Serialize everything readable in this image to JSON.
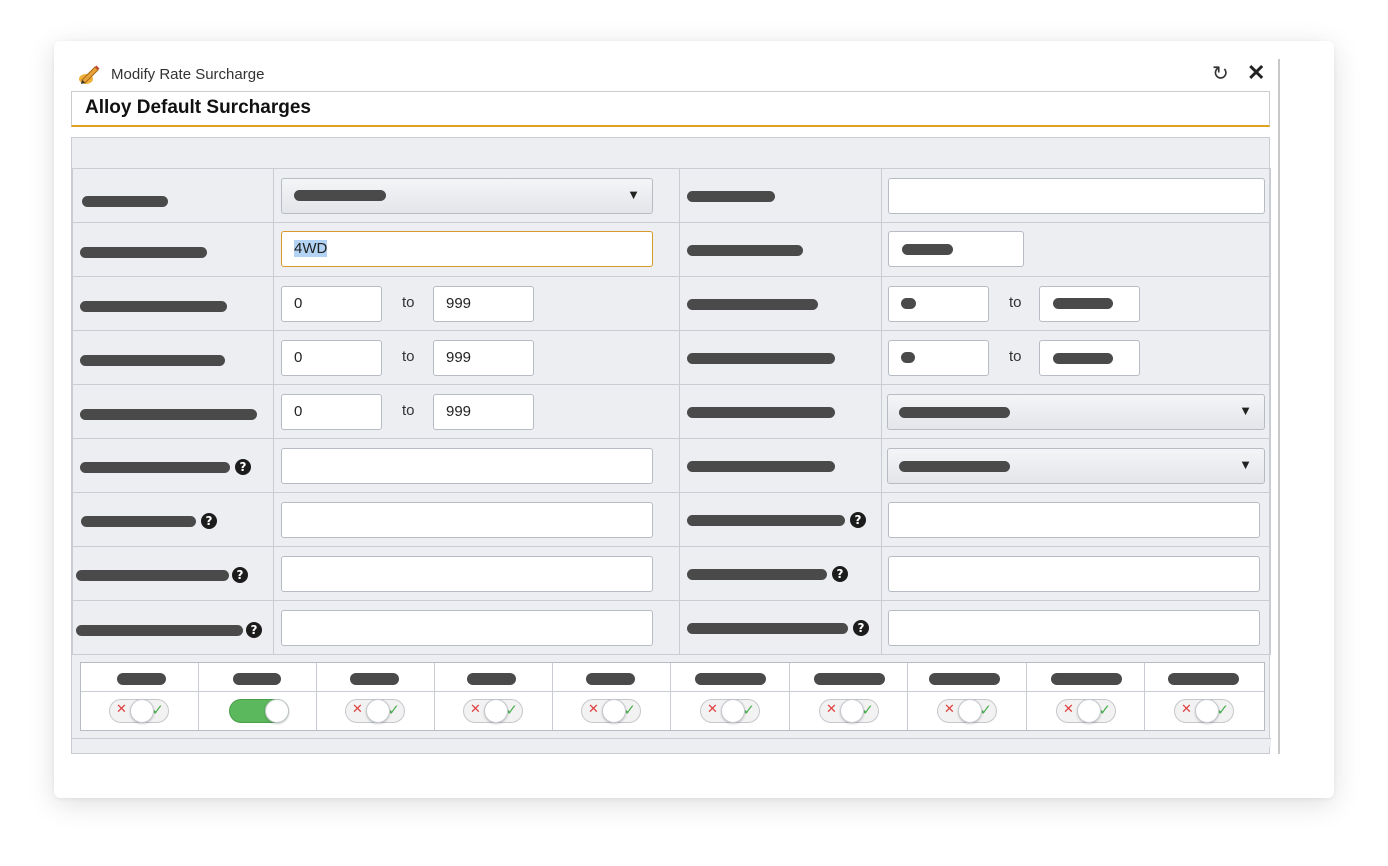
{
  "window": {
    "title": "Modify Rate Surcharge",
    "icon": "pencil-edit-icon",
    "refresh_icon": "refresh-icon",
    "close_icon": "close-icon",
    "refresh_glyph": "↻",
    "close_glyph": "✕"
  },
  "section": {
    "title": "Alloy Default Surcharges"
  },
  "form": {
    "code_value": "4WD",
    "range_rows": [
      {
        "from": "0",
        "to_label": "to",
        "to": "999"
      },
      {
        "from": "0",
        "to_label": "to",
        "to": "999"
      },
      {
        "from": "0",
        "to_label": "to",
        "to": "999"
      }
    ],
    "right_range_rows": [
      {
        "to_label": "to"
      },
      {
        "to_label": "to"
      }
    ],
    "help_glyph": "?",
    "dropdown_arrow": "▼"
  },
  "toggles": [
    {
      "state": "off"
    },
    {
      "state": "on"
    },
    {
      "state": "off"
    },
    {
      "state": "off"
    },
    {
      "state": "off"
    },
    {
      "state": "off"
    },
    {
      "state": "off"
    },
    {
      "state": "off"
    },
    {
      "state": "off"
    },
    {
      "state": "off"
    }
  ],
  "colors": {
    "accent_border": "#e0a020",
    "toggle_on": "#5cb85c",
    "toggle_x": "#e04040",
    "toggle_check": "#4caf50"
  }
}
